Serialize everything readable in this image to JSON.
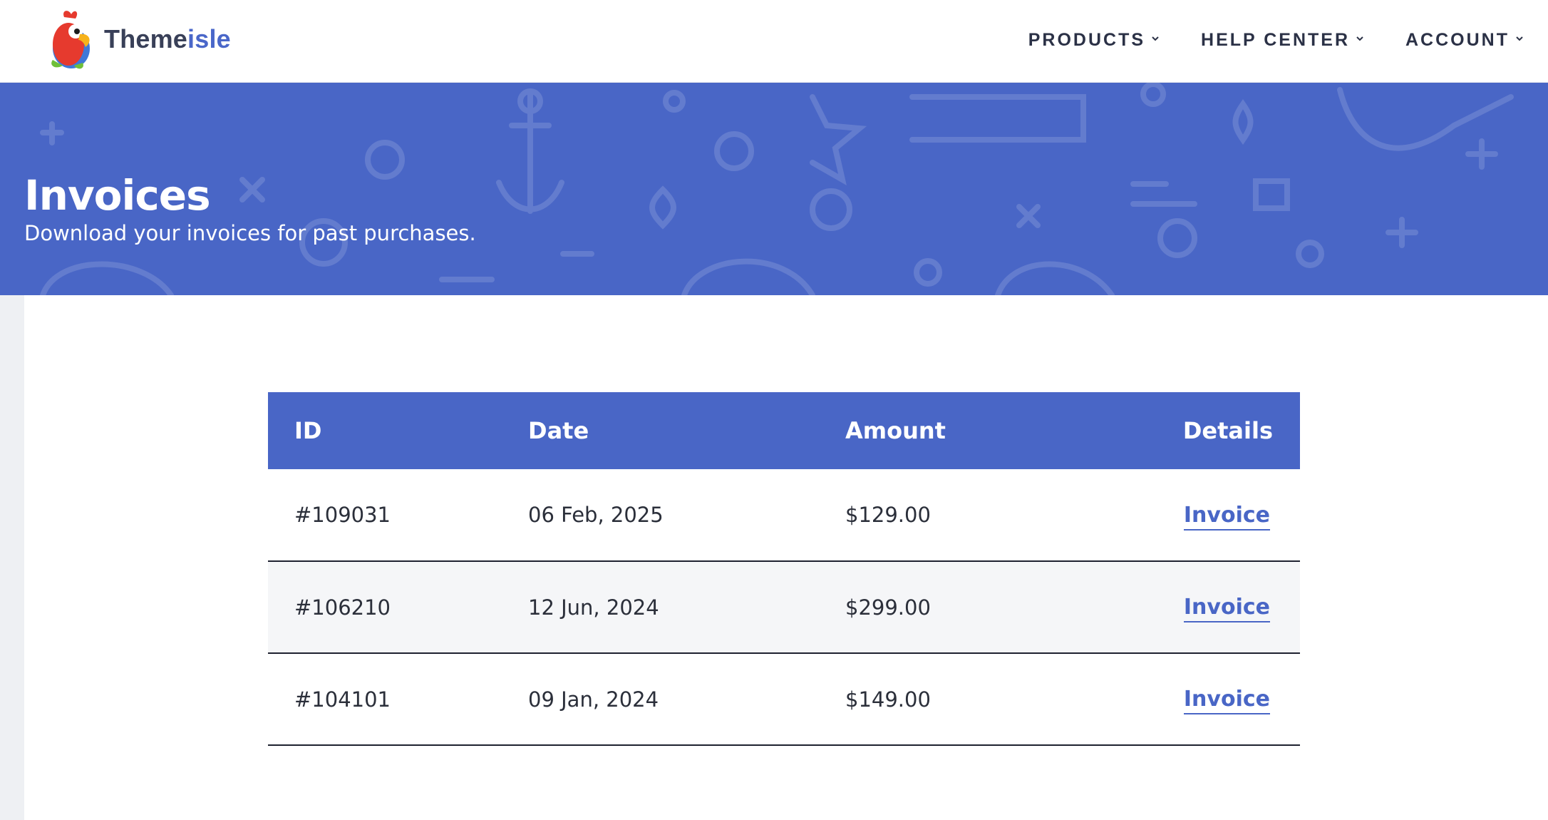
{
  "brand": {
    "name_part1": "Theme",
    "name_part2": "isle",
    "accent_color": "#4966c6"
  },
  "nav": {
    "items": [
      {
        "label": "PRODUCTS"
      },
      {
        "label": "HELP CENTER"
      },
      {
        "label": "ACCOUNT"
      }
    ]
  },
  "hero": {
    "title": "Invoices",
    "subtitle": "Download your invoices for past purchases."
  },
  "table": {
    "headers": {
      "id": "ID",
      "date": "Date",
      "amount": "Amount",
      "details": "Details"
    },
    "rows": [
      {
        "id": "#109031",
        "date": "06 Feb, 2025",
        "amount": "$129.00",
        "link": "Invoice"
      },
      {
        "id": "#106210",
        "date": "12 Jun, 2024",
        "amount": "$299.00",
        "link": "Invoice"
      },
      {
        "id": "#104101",
        "date": "09 Jan, 2024",
        "amount": "$149.00",
        "link": "Invoice"
      }
    ]
  },
  "icons": {
    "logo": "parrot-logo-icon",
    "nav_chevron": "chevron-down-icon"
  }
}
